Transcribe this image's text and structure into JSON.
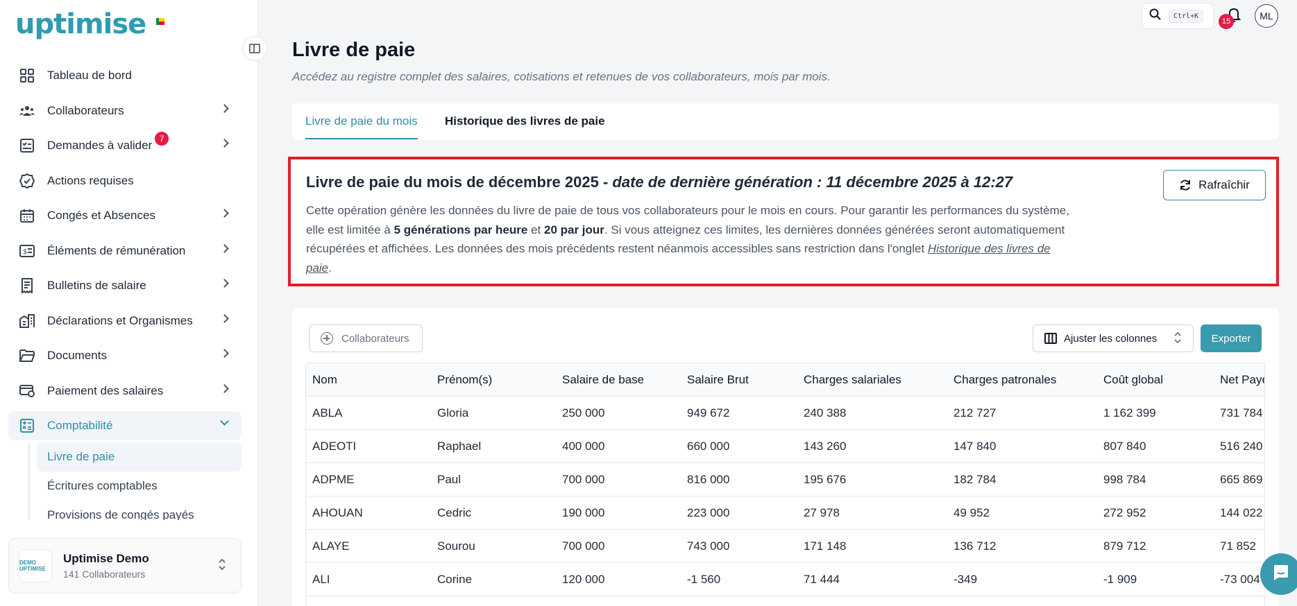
{
  "brand": {
    "name": "uptimise"
  },
  "sidebar": {
    "items": [
      {
        "label": "Tableau de bord",
        "icon": "dashboard-icon",
        "chevron": false
      },
      {
        "label": "Collaborateurs",
        "icon": "users-icon",
        "chevron": true
      },
      {
        "label": "Demandes à valider",
        "icon": "checklist-icon",
        "chevron": true,
        "badge": "7"
      },
      {
        "label": "Actions requises",
        "icon": "badge-check-icon",
        "chevron": false
      },
      {
        "label": "Congés et Absences",
        "icon": "calendar-icon",
        "chevron": true
      },
      {
        "label": "Éléments de rémunération",
        "icon": "money-icon",
        "chevron": true
      },
      {
        "label": "Bulletins de salaire",
        "icon": "receipt-icon",
        "chevron": true
      },
      {
        "label": "Déclarations et Organismes",
        "icon": "building-icon",
        "chevron": true
      },
      {
        "label": "Documents",
        "icon": "folder-icon",
        "chevron": true
      },
      {
        "label": "Paiement des salaires",
        "icon": "card-icon",
        "chevron": true
      },
      {
        "label": "Comptabilité",
        "icon": "calculator-icon",
        "chevron": true,
        "active": true
      }
    ],
    "subitems": [
      {
        "label": "Livre de paie",
        "active": true
      },
      {
        "label": "Écritures comptables"
      },
      {
        "label": "Provisions de congés payés"
      }
    ],
    "company": {
      "name": "Uptimise Demo",
      "count": "141 Collaborateurs",
      "logo_text": "DEMO UPTIMISE"
    }
  },
  "topbar": {
    "shortcut": "Ctrl+K",
    "notifications": "15",
    "avatar": "ML"
  },
  "page": {
    "title": "Livre de paie",
    "subtitle": "Accédez au registre complet des salaires, cotisations et retenues de vos collaborateurs, mois par mois."
  },
  "tabs": [
    {
      "label": "Livre de paie du mois",
      "active": true
    },
    {
      "label": "Historique des livres de paie"
    }
  ],
  "info": {
    "title_main": "Livre de paie du mois de décembre 2025 - ",
    "title_date": "date de dernière génération : 11 décembre 2025 à 12:27",
    "text_1": "Cette opération génère les données du livre de paie de tous vos collaborateurs pour le mois en cours. Pour garantir les performances du système, elle est limitée à ",
    "bold_1": "5 générations par heure",
    "text_2": " et ",
    "bold_2": "20 par jour",
    "text_3": ". Si vous atteignez ces limites, les dernières données générées seront automatiquement récupérées et affichées. Les données des mois précédents restent néanmois accessibles sans restriction dans l'onglet ",
    "link": "Historique des livres de paie",
    "text_4": ".",
    "refresh_label": "Rafraîchir"
  },
  "toolbar": {
    "collab_label": "Collaborateurs",
    "columns_label": "Ajuster les colonnes",
    "export_label": "Exporter"
  },
  "table": {
    "columns": [
      "Nom",
      "Prénom(s)",
      "Salaire de base",
      "Salaire Brut",
      "Charges salariales",
      "Charges patronales",
      "Coût global",
      "Net Payé"
    ],
    "rows": [
      [
        "ABLA",
        "Gloria",
        "250 000",
        "949 672",
        "240 388",
        "212 727",
        "1 162 399",
        "731 784"
      ],
      [
        "ADEOTI",
        "Raphael",
        "400 000",
        "660 000",
        "143 260",
        "147 840",
        "807 840",
        "516 240"
      ],
      [
        "ADPME",
        "Paul",
        "700 000",
        "816 000",
        "195 676",
        "182 784",
        "998 784",
        "665 869"
      ],
      [
        "AHOUAN",
        "Cedric",
        "190 000",
        "223 000",
        "27 978",
        "49 952",
        "272 952",
        "144 022"
      ],
      [
        "ALAYE",
        "Sourou",
        "700 000",
        "743 000",
        "171 148",
        "136 712",
        "879 712",
        "71 852"
      ],
      [
        "ALI",
        "Corine",
        "120 000",
        "-1 560",
        "71 444",
        "-349",
        "-1 909",
        "-73 004"
      ]
    ]
  },
  "colors": {
    "accent": "#2f8fa5",
    "alert_border": "#e01f2a",
    "badge": "#e11d48"
  }
}
